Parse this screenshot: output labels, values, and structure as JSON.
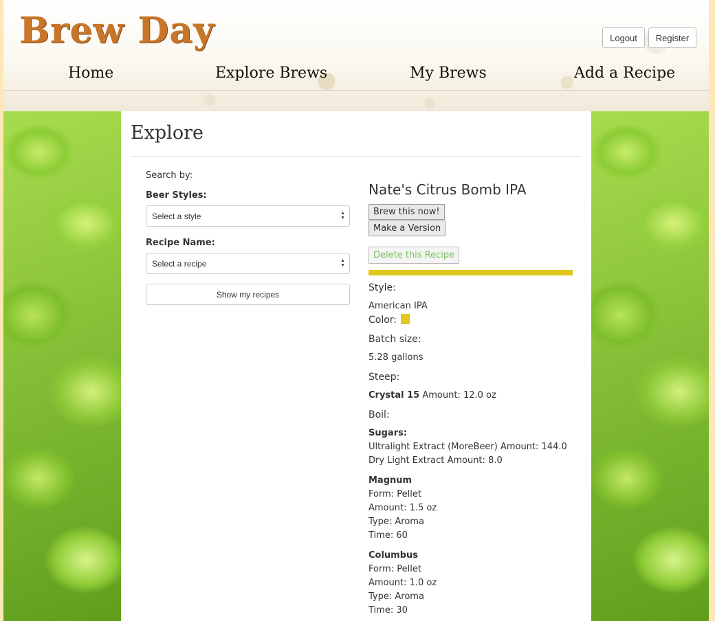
{
  "header": {
    "logo": "Brew Day",
    "logout_label": "Logout",
    "register_label": "Register",
    "nav": [
      "Home",
      "Explore Brews",
      "My Brews",
      "Add a Recipe"
    ]
  },
  "page": {
    "title": "Explore",
    "search_by": "Search by:",
    "beer_styles_label": "Beer Styles:",
    "beer_styles_value": "Select a style",
    "recipe_name_label": "Recipe Name:",
    "recipe_name_value": "Select a recipe",
    "show_my_recipes": "Show my recipes"
  },
  "recipe": {
    "name": "Nate's Citrus Bomb IPA",
    "brew_now": "Brew this now!",
    "make_version": "Make a Version",
    "delete": "Delete this Recipe",
    "color_hex": "#e0c81f",
    "style_heading": "Style:",
    "style_value": "American IPA",
    "color_heading": "Color:",
    "batch_heading": "Batch size:",
    "batch_value": "5.28 gallons",
    "steep_heading": "Steep:",
    "steep_name": "Crystal 15",
    "steep_amount": "Amount: 12.0 oz",
    "boil_heading": "Boil:",
    "sugars_heading": "Sugars:",
    "sugars": [
      "Ultralight Extract (MoreBeer) Amount: 144.0",
      "Dry Light Extract Amount: 8.0"
    ],
    "hops": [
      {
        "name": "Magnum",
        "lines": [
          "Form: Pellet",
          "Amount: 1.5 oz",
          "Type: Aroma",
          "Time: 60"
        ]
      },
      {
        "name": "Columbus",
        "lines": [
          "Form: Pellet",
          "Amount: 1.0 oz",
          "Type: Aroma",
          "Time: 30"
        ]
      }
    ]
  },
  "colors": {
    "logo": "#c8772a",
    "page_background": "#fde7b6",
    "delete_text": "#7cc060",
    "hops_green": "#8bcc34"
  }
}
